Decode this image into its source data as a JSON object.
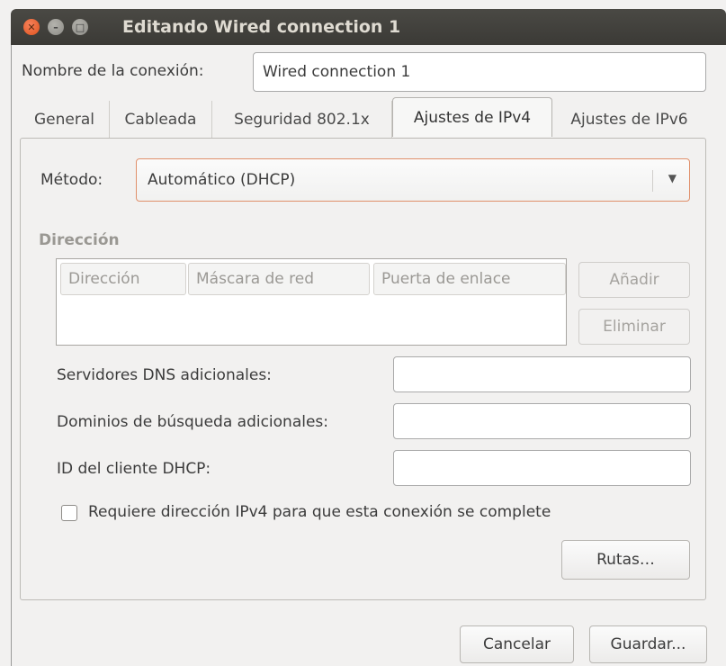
{
  "window": {
    "title": "Editando Wired connection 1",
    "close_icon": "close-icon",
    "minimize_icon": "minimize-icon",
    "maximize_icon": "maximize-icon"
  },
  "connection": {
    "name_label": "Nombre de la conexión:",
    "name_value": "Wired connection 1"
  },
  "tabs": [
    {
      "label": "General"
    },
    {
      "label": "Cableada"
    },
    {
      "label": "Seguridad 802.1x"
    },
    {
      "label": "Ajustes de IPv4",
      "active": true
    },
    {
      "label": "Ajustes de IPv6"
    }
  ],
  "ipv4": {
    "method_label": "Método:",
    "method_value": "Automático (DHCP)",
    "address_section": "Dirección",
    "columns": [
      "Dirección",
      "Máscara de red",
      "Puerta de enlace"
    ],
    "add_button": "Añadir",
    "remove_button": "Eliminar",
    "dns_label": "Servidores DNS adicionales:",
    "dns_value": "",
    "search_label": "Dominios de búsqueda adicionales:",
    "search_value": "",
    "dhcp_id_label": "ID del cliente DHCP:",
    "dhcp_id_value": "",
    "require_label": "Requiere dirección IPv4 para que esta conexión se complete",
    "require_checked": false,
    "routes_button": "Rutas…"
  },
  "footer": {
    "cancel_button": "Cancelar",
    "save_button": "Guardar..."
  },
  "colors": {
    "titlebar": "#3c3b37",
    "close_button": "#e95420",
    "focus_border": "#e0906b",
    "background": "#f2f1f0"
  }
}
